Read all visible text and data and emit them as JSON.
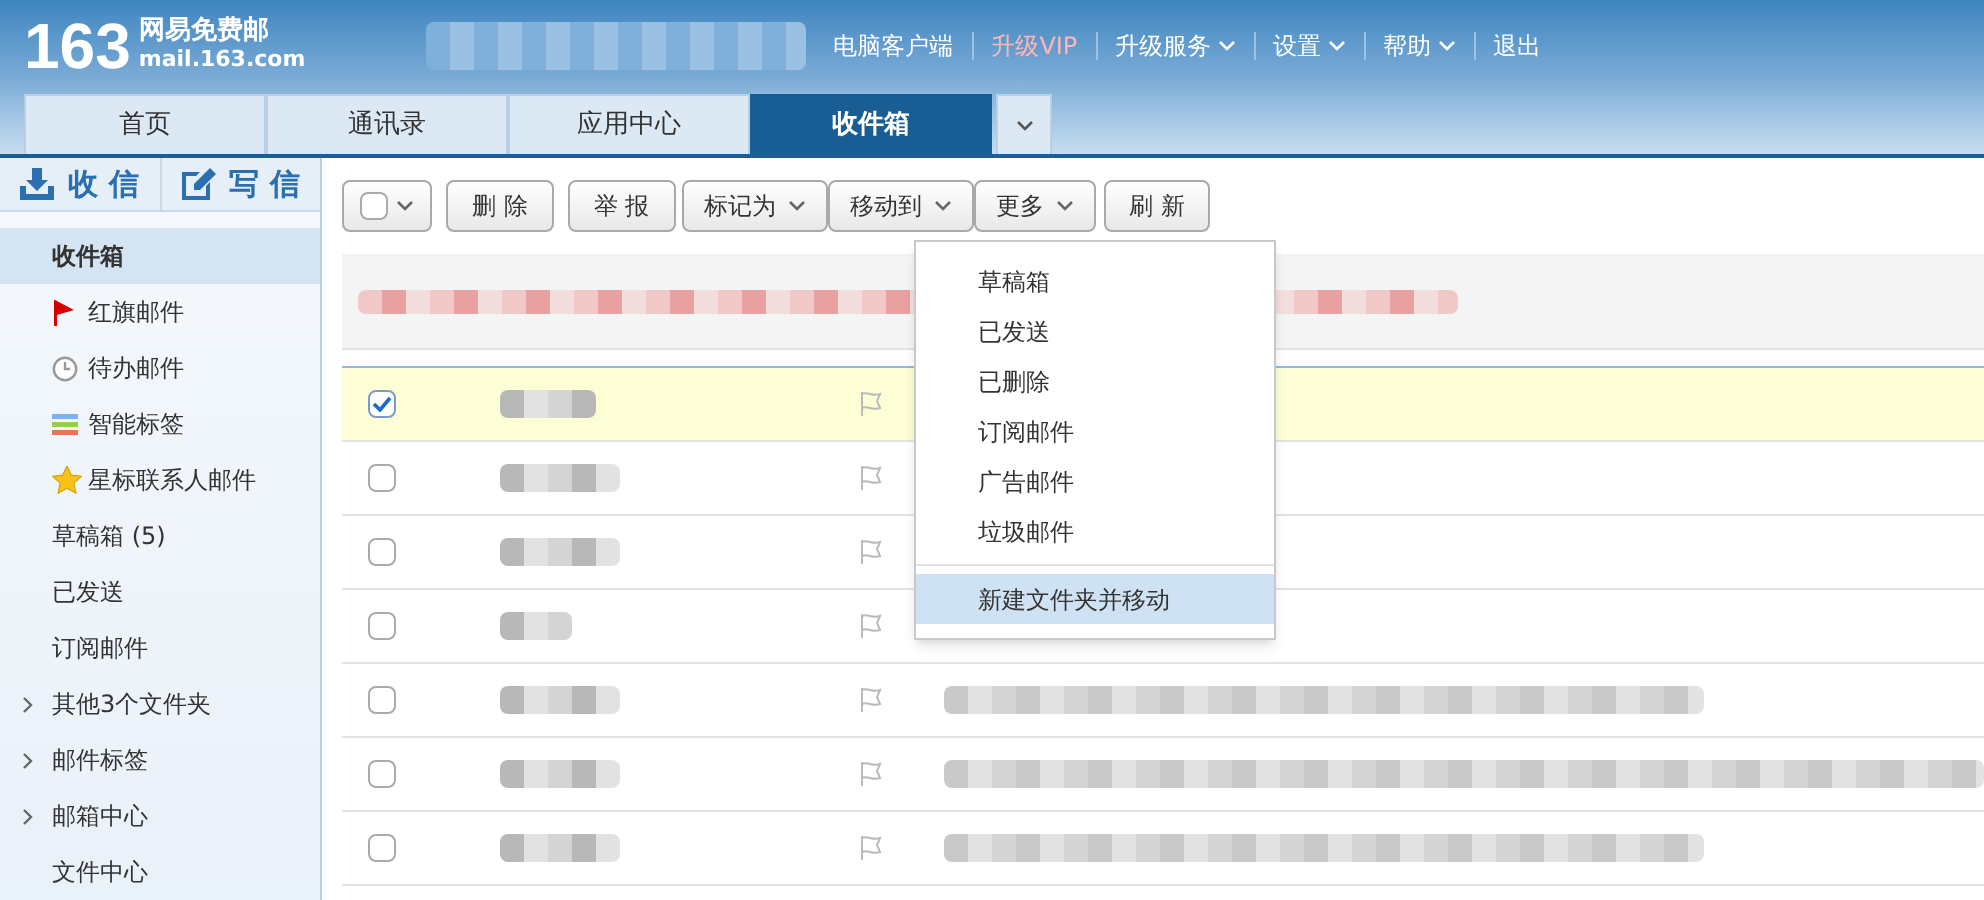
{
  "logo": {
    "number": "163",
    "name": "网易免费邮",
    "domain": "mail.163.com"
  },
  "top_links": [
    {
      "label": "电脑客户端",
      "kind": "link"
    },
    {
      "label": "升级VIP",
      "kind": "vip"
    },
    {
      "label": "升级服务",
      "kind": "menu"
    },
    {
      "label": "设置",
      "kind": "menu"
    },
    {
      "label": "帮助",
      "kind": "menu"
    },
    {
      "label": "退出",
      "kind": "link"
    }
  ],
  "tabs": [
    {
      "label": "首页",
      "selected": false
    },
    {
      "label": "通讯录",
      "selected": false
    },
    {
      "label": "应用中心",
      "selected": false
    },
    {
      "label": "收件箱",
      "selected": true
    }
  ],
  "actions": [
    {
      "label": "收 信",
      "kind": "receive"
    },
    {
      "label": "写 信",
      "kind": "compose"
    }
  ],
  "sidebar": {
    "items": [
      {
        "label": "收件箱",
        "kind": "plain",
        "selected": true
      },
      {
        "label": "红旗邮件",
        "kind": "flag",
        "selected": false
      },
      {
        "label": "待办邮件",
        "kind": "clock",
        "selected": false
      },
      {
        "label": "智能标签",
        "kind": "tags",
        "selected": false
      },
      {
        "label": "星标联系人邮件",
        "kind": "star",
        "selected": false
      },
      {
        "label": "草稿箱 (5)",
        "kind": "plain",
        "selected": false
      },
      {
        "label": "已发送",
        "kind": "plain",
        "selected": false
      },
      {
        "label": "订阅邮件",
        "kind": "plain",
        "selected": false
      },
      {
        "label": "其他3个文件夹",
        "kind": "group",
        "selected": false
      },
      {
        "label": "邮件标签",
        "kind": "group",
        "selected": false
      },
      {
        "label": "邮箱中心",
        "kind": "group",
        "selected": false
      },
      {
        "label": "文件中心",
        "kind": "plain",
        "selected": false
      }
    ]
  },
  "toolbar": [
    {
      "label": "删 除",
      "kind": "button"
    },
    {
      "label": "举 报",
      "kind": "button"
    },
    {
      "label": "标记为",
      "kind": "menu"
    },
    {
      "label": "移动到",
      "kind": "menu"
    },
    {
      "label": "更多",
      "kind": "menu"
    },
    {
      "label": "刷 新",
      "kind": "button"
    }
  ],
  "move_menu": {
    "items": [
      {
        "label": "草稿箱",
        "selected": false
      },
      {
        "label": "已发送",
        "selected": false
      },
      {
        "label": "已删除",
        "selected": false
      },
      {
        "label": "订阅邮件",
        "selected": false
      },
      {
        "label": "广告邮件",
        "selected": false
      },
      {
        "label": "垃圾邮件",
        "selected": false
      },
      {
        "label": "新建文件夹并移动",
        "selected": true
      }
    ]
  },
  "messages": [
    {
      "checked": true
    },
    {
      "checked": false
    },
    {
      "checked": false
    },
    {
      "checked": false
    },
    {
      "checked": false
    },
    {
      "checked": false
    },
    {
      "checked": false
    }
  ]
}
